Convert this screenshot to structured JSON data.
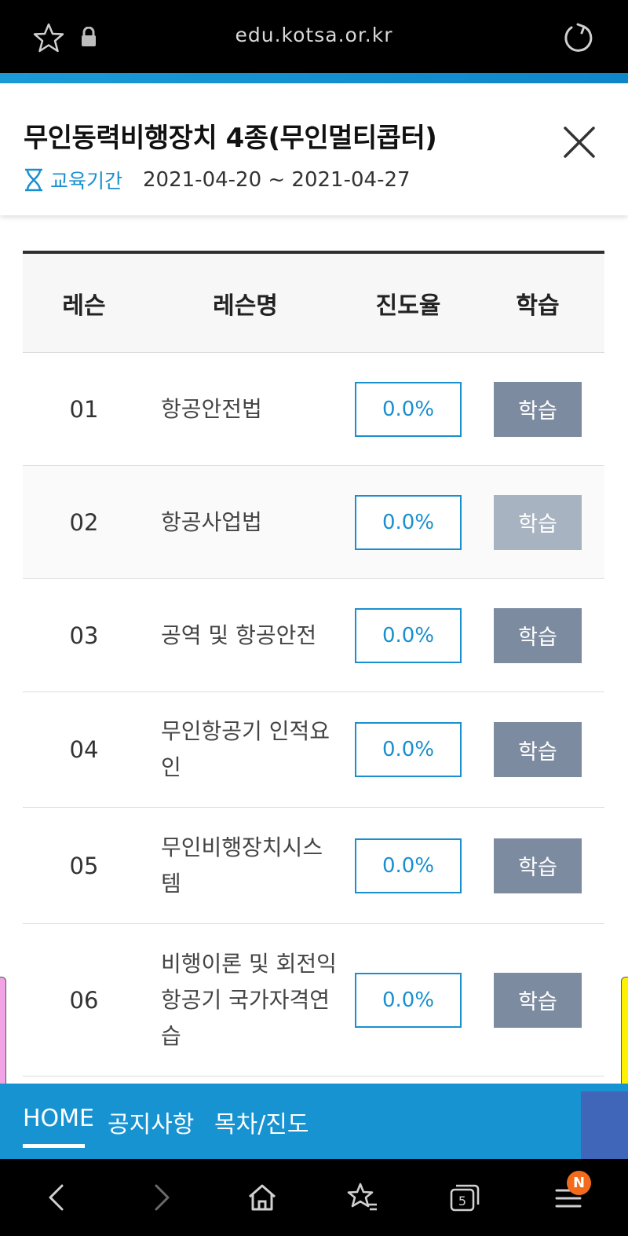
{
  "browser": {
    "url": "edu.kotsa.or.kr",
    "tab_count": "5",
    "menu_badge": "N"
  },
  "header": {
    "title": "무인동력비행장치 4종(무인멀티콥터)",
    "period_label": "교육기간",
    "period_value": "2021-04-20 ~ 2021-04-27"
  },
  "table": {
    "headers": {
      "lesson": "레슨",
      "lesson_name": "레슨명",
      "progress": "진도율",
      "study": "학습"
    },
    "rows": [
      {
        "num": "01",
        "name": "항공안전법",
        "progress": "0.0%",
        "button": "학습"
      },
      {
        "num": "02",
        "name": "항공사업법",
        "progress": "0.0%",
        "button": "학습"
      },
      {
        "num": "03",
        "name": "공역 및 항공안전",
        "progress": "0.0%",
        "button": "학습"
      },
      {
        "num": "04",
        "name": "무인항공기 인적요인",
        "progress": "0.0%",
        "button": "학습"
      },
      {
        "num": "05",
        "name": "무인비행장치시스템",
        "progress": "0.0%",
        "button": "학습"
      },
      {
        "num": "06",
        "name": "비행이론 및 회전익 항공기 국가자격연습",
        "progress": "0.0%",
        "button": "학습"
      }
    ]
  },
  "sitenav": {
    "home": "HOME",
    "notice": "공지사항",
    "toc": "목차/진도"
  },
  "colors": {
    "accent_blue": "#1a8fcf",
    "nav_blue": "#1893d2",
    "button_gray": "#7d8ba0",
    "badge_orange": "#f26b1d"
  }
}
